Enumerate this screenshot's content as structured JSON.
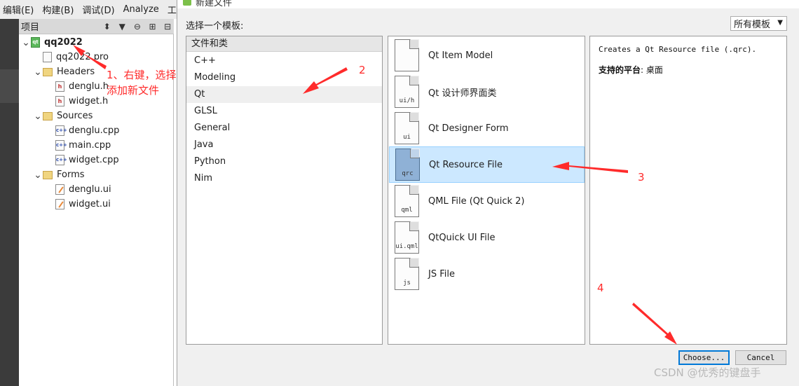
{
  "menubar": [
    "编辑(E)",
    "构建(B)",
    "调试(D)",
    "Analyze",
    "工"
  ],
  "project_panel": {
    "title": "项目",
    "tree": [
      {
        "label": "qq2022",
        "icon": "qt-project-icon",
        "level": 0,
        "expanded": true
      },
      {
        "label": "qq2022.pro",
        "icon": "pro-file-icon",
        "level": 1
      },
      {
        "label": "Headers",
        "icon": "folder-icon",
        "level": 1,
        "expanded": true
      },
      {
        "label": "denglu.h",
        "icon": "header-file-icon",
        "level": 2
      },
      {
        "label": "widget.h",
        "icon": "header-file-icon",
        "level": 2
      },
      {
        "label": "Sources",
        "icon": "folder-icon",
        "level": 1,
        "expanded": true
      },
      {
        "label": "denglu.cpp",
        "icon": "cpp-file-icon",
        "level": 2
      },
      {
        "label": "main.cpp",
        "icon": "cpp-file-icon",
        "level": 2
      },
      {
        "label": "widget.cpp",
        "icon": "cpp-file-icon",
        "level": 2
      },
      {
        "label": "Forms",
        "icon": "folder-icon",
        "level": 1,
        "expanded": true
      },
      {
        "label": "denglu.ui",
        "icon": "ui-form-icon",
        "level": 2
      },
      {
        "label": "widget.ui",
        "icon": "ui-form-icon",
        "level": 2
      }
    ]
  },
  "dialog": {
    "title": "新建文件",
    "choose_template_label": "选择一个模板:",
    "filter": "所有模板",
    "categories_header": "文件和类",
    "categories": [
      "C++",
      "Modeling",
      "Qt",
      "GLSL",
      "General",
      "Java",
      "Python",
      "Nim"
    ],
    "selected_category": "Qt",
    "templates": [
      {
        "name": "Qt Item Model",
        "ext": ""
      },
      {
        "name": "Qt 设计师界面类",
        "ext": "ui/h"
      },
      {
        "name": "Qt Designer Form",
        "ext": "ui"
      },
      {
        "name": "Qt Resource File",
        "ext": "qrc"
      },
      {
        "name": "QML File (Qt Quick 2)",
        "ext": "qml"
      },
      {
        "name": "QtQuick UI File",
        "ext": "ui.qml"
      },
      {
        "name": "JS File",
        "ext": "js"
      }
    ],
    "selected_template": "Qt Resource File",
    "description": "Creates a Qt Resource file (.qrc).",
    "platform_label": "支持的平台",
    "platform_value": ": 桌面",
    "choose_button": "Choose...",
    "cancel_button": "Cancel"
  },
  "annotations": {
    "step1_line1": "1、右键，选择",
    "step1_line2": "添加新文件",
    "step2": "2",
    "step3": "3",
    "step4": "4",
    "color": "#ff2b2b"
  },
  "watermark": "CSDN @优秀的键盘手"
}
